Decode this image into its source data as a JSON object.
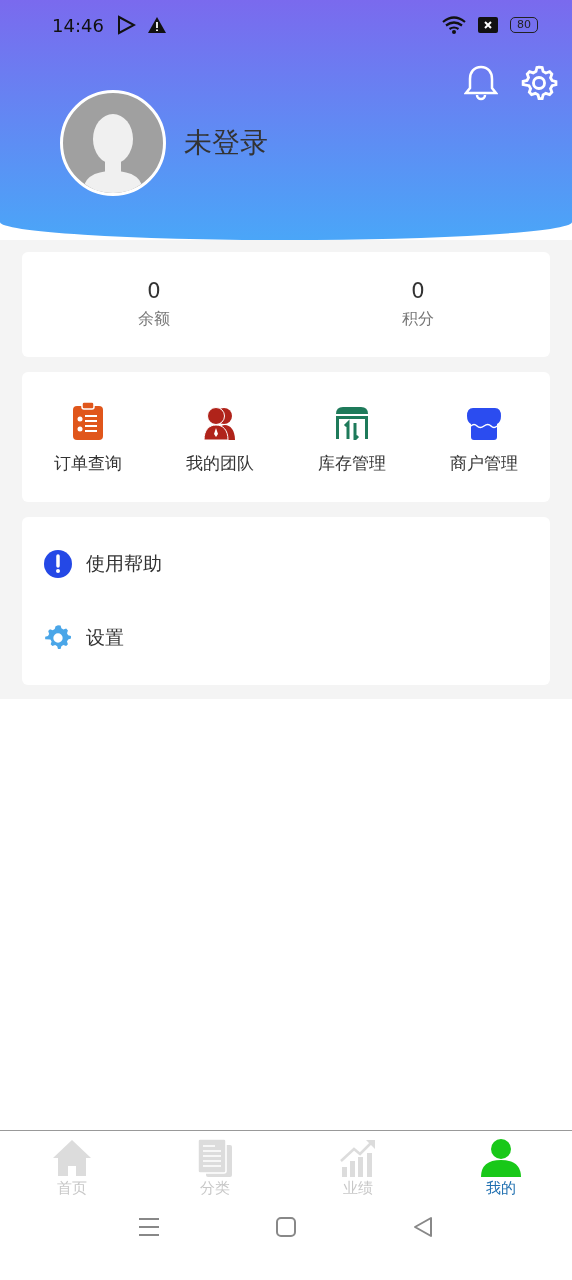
{
  "status_bar": {
    "time": "14:46",
    "battery": "80"
  },
  "header": {
    "username": "未登录"
  },
  "stats": [
    {
      "value": "0",
      "label": "余额"
    },
    {
      "value": "0",
      "label": "积分"
    }
  ],
  "shortcuts": [
    {
      "label": "订单查询",
      "kind": "clipboard",
      "color": "#e0561b"
    },
    {
      "label": "我的团队",
      "kind": "team",
      "color": "#b0231a"
    },
    {
      "label": "库存管理",
      "kind": "warehouse",
      "color": "#1e7a5a"
    },
    {
      "label": "商户管理",
      "kind": "shop",
      "color": "#2b4cf0"
    }
  ],
  "menu": [
    {
      "label": "使用帮助",
      "kind": "help"
    },
    {
      "label": "设置",
      "kind": "settings"
    }
  ],
  "tab_bar": [
    {
      "label": "首页",
      "kind": "home",
      "selected": false
    },
    {
      "label": "分类",
      "kind": "docs",
      "selected": false
    },
    {
      "label": "业绩",
      "kind": "chart",
      "selected": false
    },
    {
      "label": "我的",
      "kind": "person",
      "selected": true
    }
  ]
}
